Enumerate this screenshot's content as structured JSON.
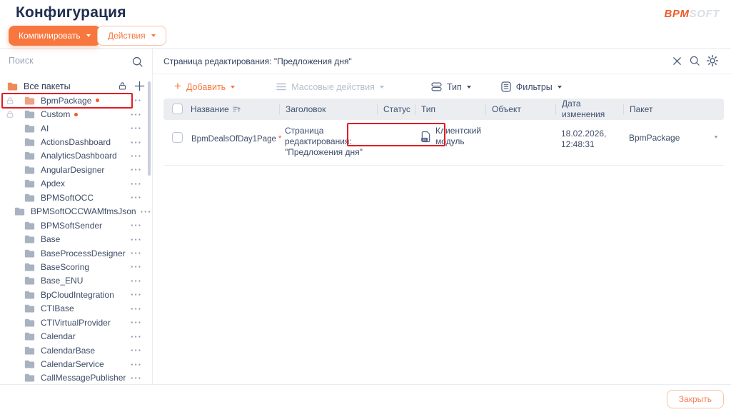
{
  "header": {
    "title": "Конфигурация",
    "compile_label": "Компилировать",
    "actions_label": "Действия",
    "logo_bpm": "BPM",
    "logo_soft": "SOFT"
  },
  "sidebar": {
    "search_placeholder": "Поиск",
    "all_packages_label": "Все пакеты",
    "packages": [
      {
        "name": "BpmPackage",
        "locked": true,
        "modified": true,
        "folder": "orange",
        "annotated": true
      },
      {
        "name": "Custom",
        "locked": true,
        "modified": true,
        "folder": "gray"
      },
      {
        "name": "AI",
        "folder": "gray"
      },
      {
        "name": "ActionsDashboard",
        "folder": "gray"
      },
      {
        "name": "AnalyticsDashboard",
        "folder": "gray"
      },
      {
        "name": "AngularDesigner",
        "folder": "gray"
      },
      {
        "name": "Apdex",
        "folder": "gray"
      },
      {
        "name": "BPMSoftOCC",
        "folder": "gray"
      },
      {
        "name": "BPMSoftOCCWAMfmsJson",
        "folder": "gray"
      },
      {
        "name": "BPMSoftSender",
        "folder": "gray"
      },
      {
        "name": "Base",
        "folder": "gray"
      },
      {
        "name": "BaseProcessDesigner",
        "folder": "gray"
      },
      {
        "name": "BaseScoring",
        "folder": "gray"
      },
      {
        "name": "Base_ENU",
        "folder": "gray"
      },
      {
        "name": "BpCloudIntegration",
        "folder": "gray"
      },
      {
        "name": "CTIBase",
        "folder": "gray"
      },
      {
        "name": "CTIVirtualProvider",
        "folder": "gray"
      },
      {
        "name": "Calendar",
        "folder": "gray"
      },
      {
        "name": "CalendarBase",
        "folder": "gray"
      },
      {
        "name": "CalendarService",
        "folder": "gray"
      },
      {
        "name": "CallMessagePublisher",
        "folder": "gray"
      }
    ]
  },
  "main": {
    "filter_value": "Страница редактирования: \"Предложения дня\"",
    "toolbar": {
      "add_label": "Добавить",
      "bulk_label": "Массовые действия",
      "type_label": "Тип",
      "filters_label": "Фильтры"
    },
    "table": {
      "columns": [
        "Название",
        "Заголовок",
        "Статус",
        "Тип",
        "Объект",
        "Дата изменения",
        "Пакет"
      ],
      "rows": [
        {
          "name": "BpmDealsOfDay1Page",
          "modified_marker": "*",
          "title": "Страница редактирования: \"Предложения дня\"",
          "status": "",
          "type_label": "Клиентский модуль",
          "object": "",
          "modified_on": "18.02.2026, 12:48:31",
          "package": "BpmPackage"
        }
      ]
    }
  },
  "footer": {
    "close_label": "Закрыть"
  },
  "colors": {
    "accent": "#f8773f",
    "logo_orange": "#f05a28",
    "annotation_red": "#e01d23",
    "modified_mark": "#f05a28",
    "table_header_bg": "#ebedf1"
  },
  "icons": {
    "search": "magnifier",
    "clear_filter": "x-cross",
    "settings": "gear",
    "install_package": "padlock",
    "add_package": "plus",
    "package_menu": "ellipsis",
    "package_lock": "padlock",
    "package_folder": "folder",
    "sort": "sort-ascending",
    "add": "plus",
    "bulk_actions": "hamburger",
    "type_filter": "layers",
    "filters": "list-box",
    "client_module": "js-file",
    "dropdown": "triangle-down"
  }
}
